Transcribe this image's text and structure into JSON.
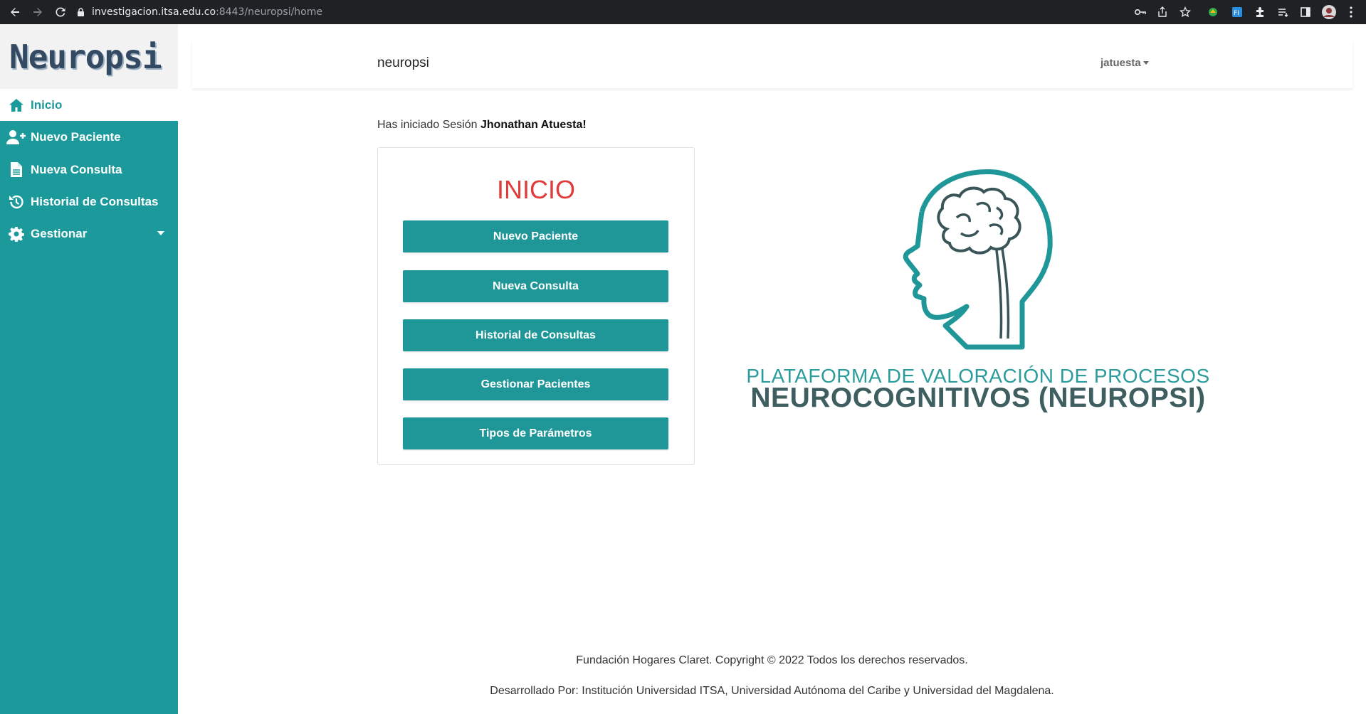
{
  "browser": {
    "url_host": "investigacion.itsa.edu.co",
    "url_path": ":8443/neuropsi/home"
  },
  "sidebar": {
    "logo": "Neuropsi",
    "items": [
      {
        "label": "Inicio",
        "icon": "home-icon",
        "active": true
      },
      {
        "label": "Nuevo Paciente",
        "icon": "user-plus-icon"
      },
      {
        "label": "Nueva Consulta",
        "icon": "document-icon"
      },
      {
        "label": "Historial de Consultas",
        "icon": "history-icon"
      },
      {
        "label": "Gestionar",
        "icon": "gear-icon",
        "has_dropdown": true
      }
    ]
  },
  "header": {
    "brand": "neuropsi",
    "user": "jatuesta"
  },
  "session": {
    "prefix": "Has iniciado Sesión",
    "name": "Jhonathan Atuesta!"
  },
  "card": {
    "title": "INICIO",
    "buttons": [
      "Nuevo Paciente",
      "Nueva Consulta",
      "Historial de Consultas",
      "Gestionar Pacientes",
      "Tipos de Parámetros"
    ]
  },
  "platform": {
    "line1": "PLATAFORMA DE VALORACIÓN DE PROCESOS",
    "line2": "NEUROCOGNITIVOS (NEUROPSI)"
  },
  "footer": {
    "line1": "Fundación Hogares Claret. Copyright © 2022 Todos los derechos reservados.",
    "line2": "Desarrollado Por: Institución Universidad ITSA, Universidad Autónoma del Caribe y Universidad del Magdalena."
  },
  "colors": {
    "accent": "#1c9a9b",
    "title_red": "#e03a3a",
    "heading_dark": "#3e5e60"
  }
}
